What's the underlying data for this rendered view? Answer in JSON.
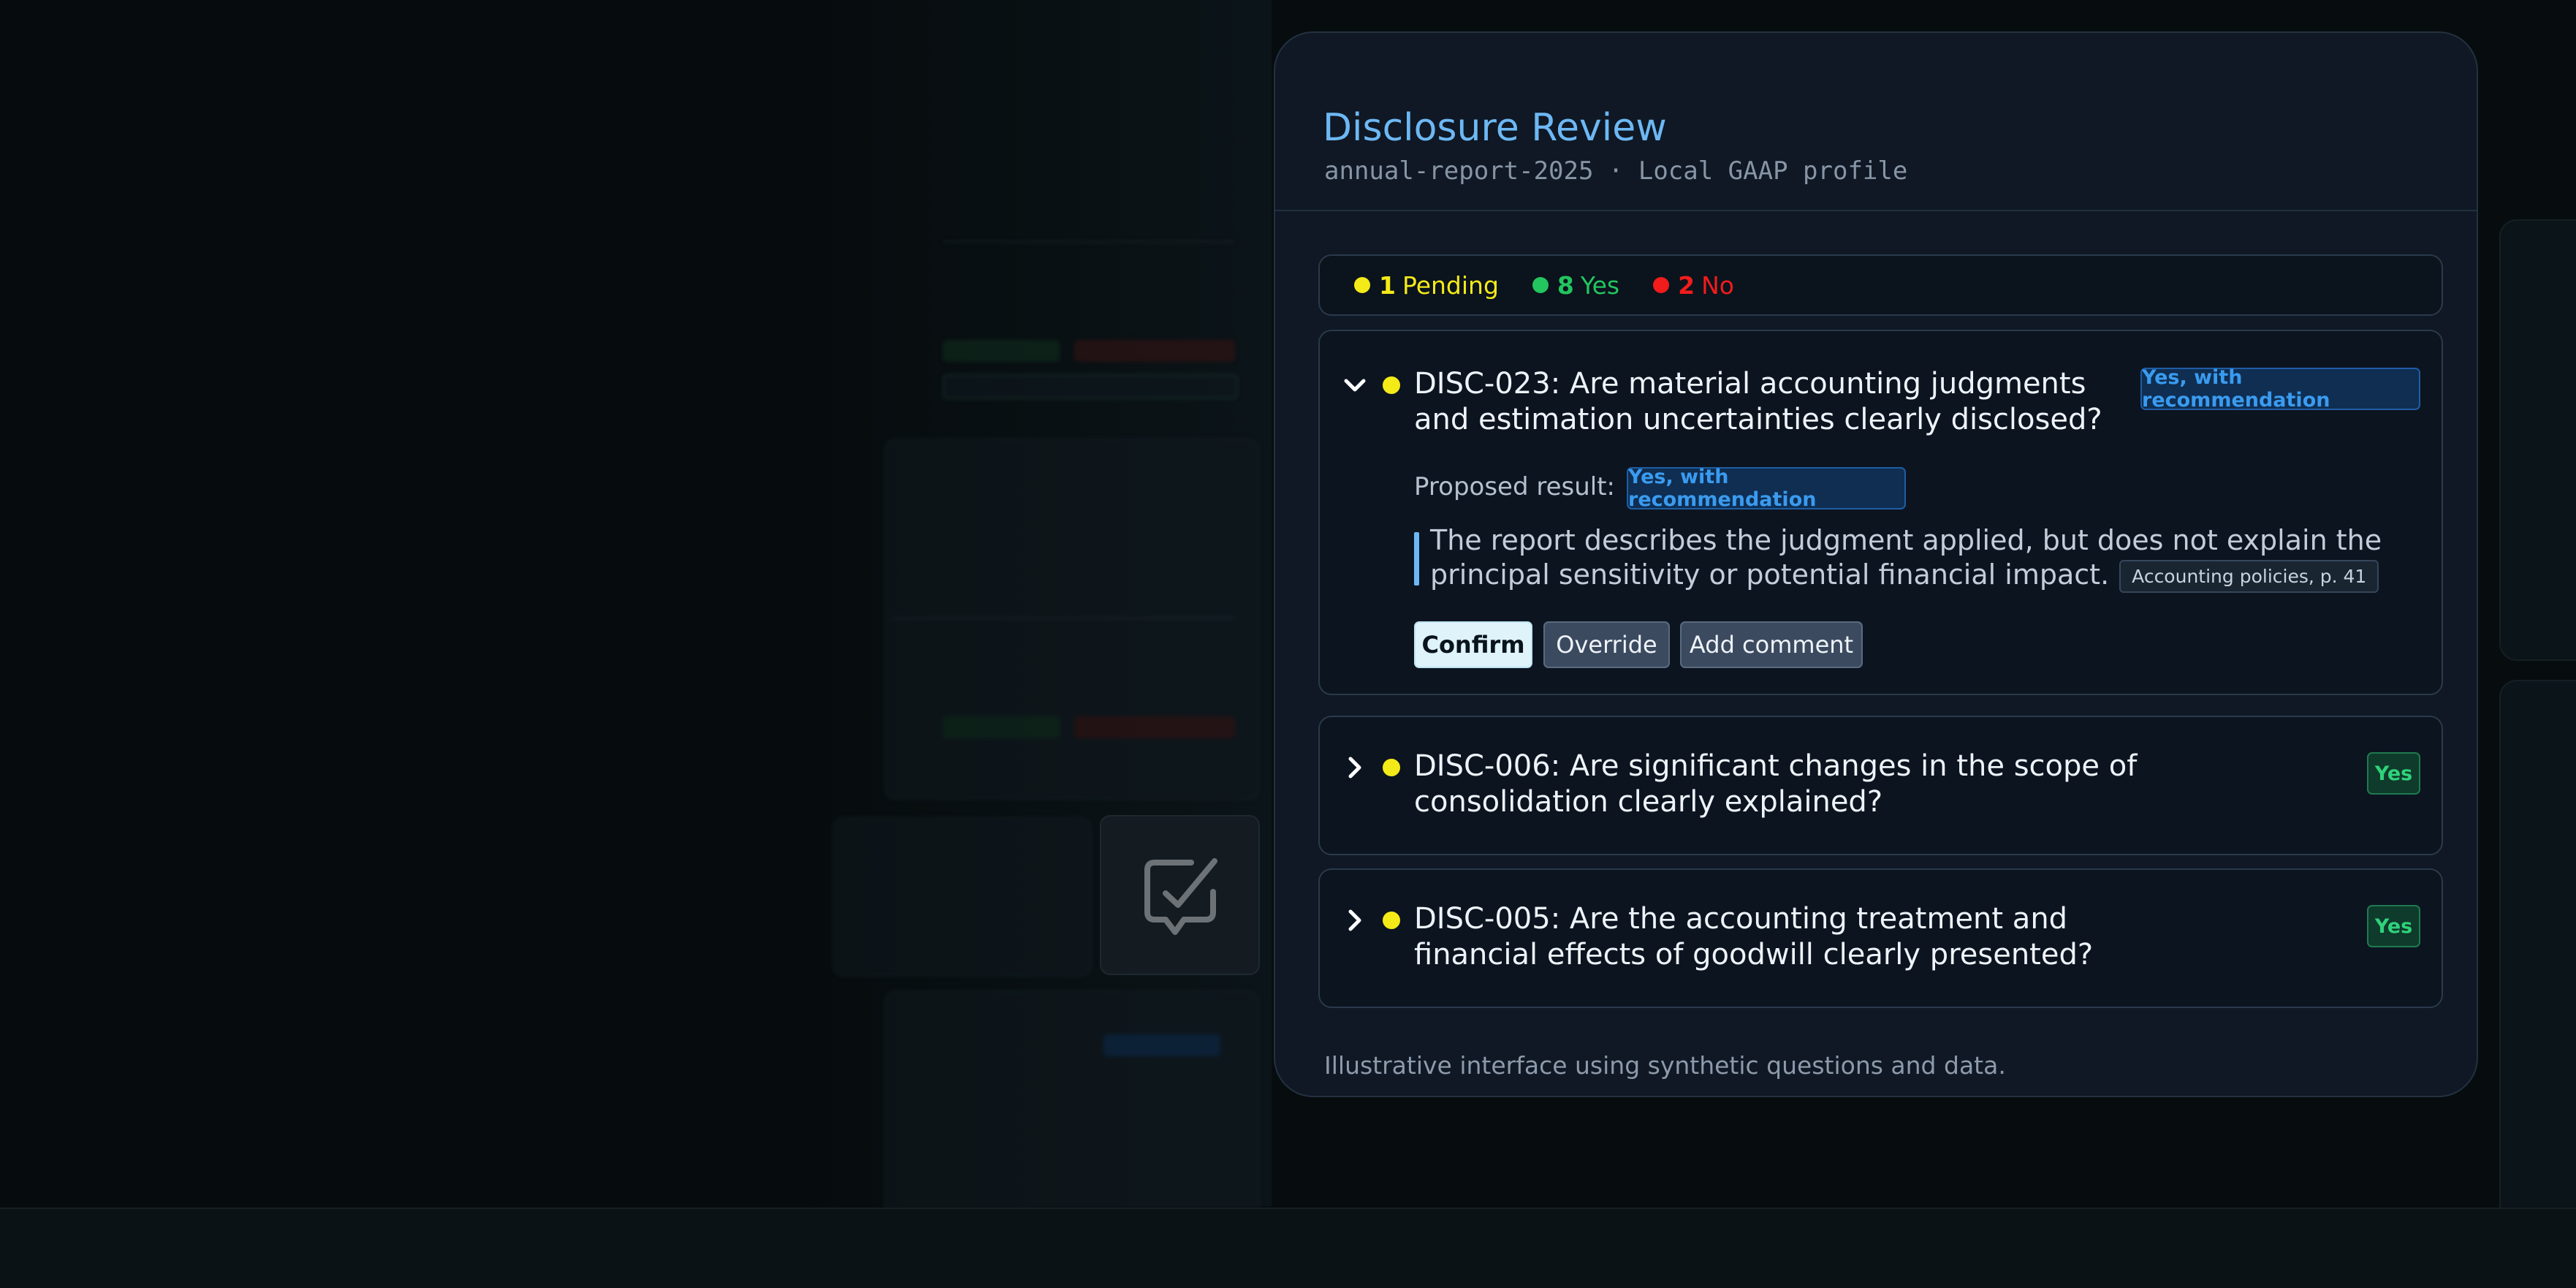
{
  "panel": {
    "title": "Disclosure Review",
    "subtitle": "annual-report-2025 · Local GAAP profile",
    "footer_note": "Illustrative interface using synthetic questions and data."
  },
  "summary": {
    "pending": {
      "count": "1",
      "label": "Pending",
      "color": "#f4ea18"
    },
    "yes": {
      "count": "8",
      "label": "Yes",
      "color": "#22c55e"
    },
    "no": {
      "count": "2",
      "label": "No",
      "color": "#f11c1c"
    }
  },
  "items": [
    {
      "question": "DISC-023: Are material accounting judgments and estimation uncertainties clearly disclosed?",
      "badge": "Yes, with recommendation",
      "expanded": true,
      "status": "pending",
      "icon": "chevron-down-icon",
      "proposed_label": "Proposed result:",
      "proposed_badge": "Yes, with recommendation",
      "rationale": "The report describes the judgment applied, but does not explain the principal sensitivity or potential financial impact.",
      "reference": "Accounting policies, p. 41",
      "actions": {
        "confirm": "Confirm",
        "override": "Override",
        "comment": "Add comment"
      }
    },
    {
      "question": "DISC-006: Are significant changes in the scope of consolidation clearly explained?",
      "badge": "Yes",
      "expanded": false,
      "status": "pending",
      "icon": "chevron-right-icon"
    },
    {
      "question": "DISC-005: Are the accounting treatment and financial effects of goodwill clearly presented?",
      "badge": "Yes",
      "expanded": false,
      "status": "pending",
      "icon": "chevron-right-icon"
    }
  ]
}
